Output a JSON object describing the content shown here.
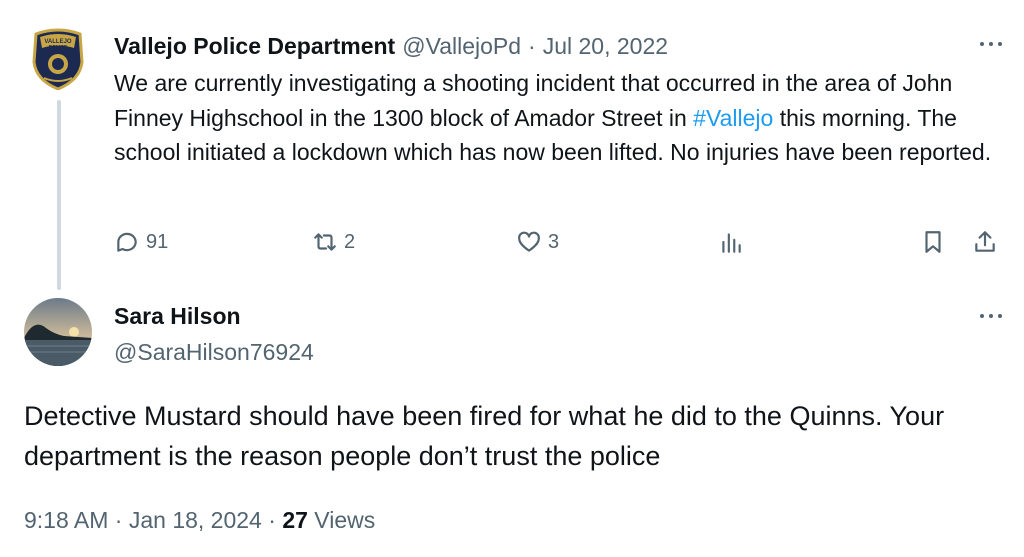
{
  "parent_tweet": {
    "author_name": "Vallejo Police Department",
    "handle": "@VallejoPd",
    "separator": "·",
    "date": "Jul 20, 2022",
    "text_before_hashtag": "We are currently investigating a shooting incident that occurred in the area of John Finney Highschool in the 1300 block of Amador Street in ",
    "hashtag": "#Vallejo",
    "text_after_hashtag": " this morning.  The school initiated a lockdown which has now been lifted. No injuries have been reported.",
    "replies": "91",
    "reposts": "2",
    "likes": "3",
    "avatar_icon": "police-badge-icon"
  },
  "reply_tweet": {
    "author_name": "Sara Hilson",
    "handle": "@SaraHilson76924",
    "text": "Detective Mustard should have been fired for what he did to the Quinns. Your department is the reason people don’t trust the police",
    "time": "9:18 AM",
    "separator": "·",
    "date": "Jan 18, 2024",
    "views_count": "27",
    "views_label": "Views",
    "avatar_icon": "sunset-landscape-avatar"
  },
  "colors": {
    "text_primary": "#0f1419",
    "text_secondary": "#536471",
    "link": "#1d9bf0",
    "thread_line": "#cfd9de"
  }
}
